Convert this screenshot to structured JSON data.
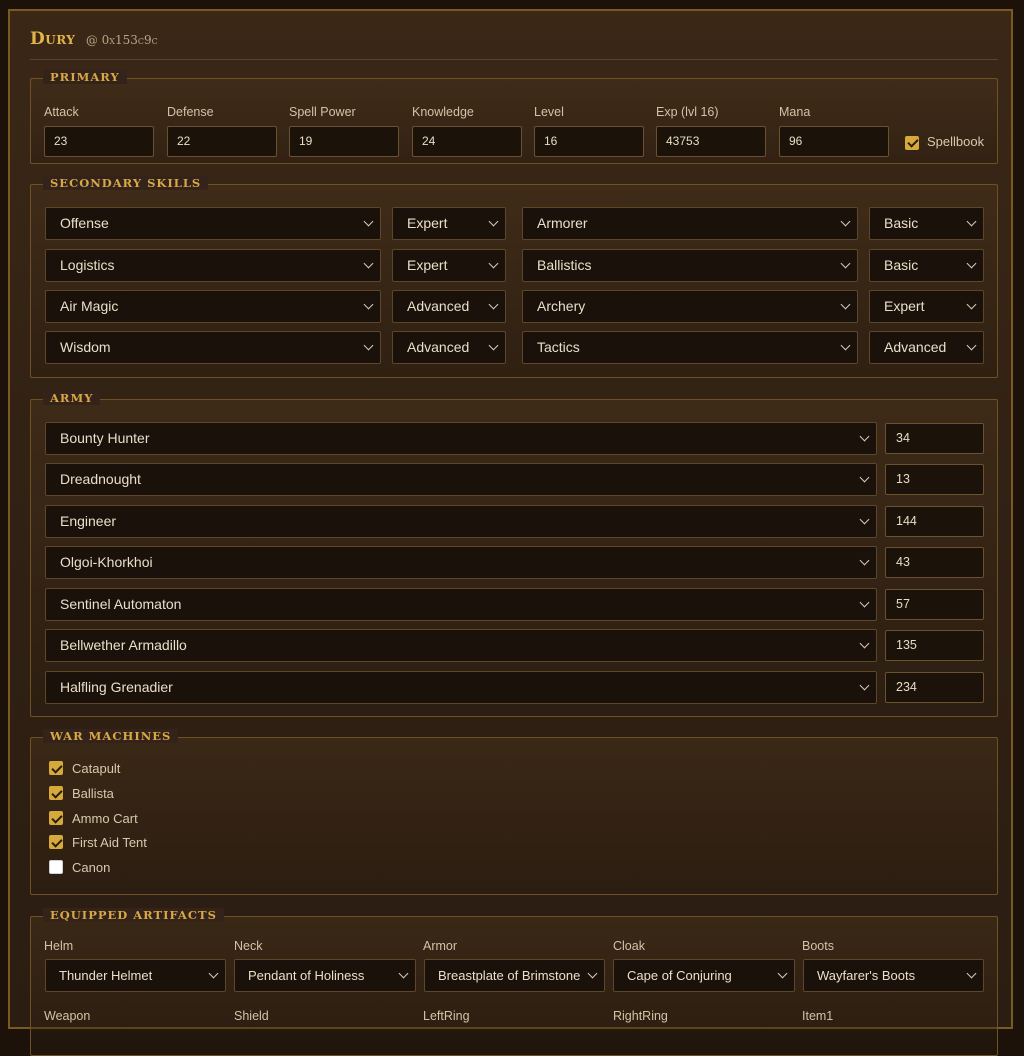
{
  "hero": {
    "name": "Dury",
    "address": "@ 0x153c9c"
  },
  "primary": {
    "legend": "PRIMARY",
    "stats": [
      {
        "label": "Attack",
        "value": "23"
      },
      {
        "label": "Defense",
        "value": "22"
      },
      {
        "label": "Spell Power",
        "value": "19"
      },
      {
        "label": "Knowledge",
        "value": "24"
      },
      {
        "label": "Level",
        "value": "16"
      },
      {
        "label": "Exp (lvl 16)",
        "value": "43753"
      },
      {
        "label": "Mana",
        "value": "96"
      }
    ],
    "spellbook_label": "Spellbook",
    "spellbook_checked": true
  },
  "secondary": {
    "legend": "SECONDARY SKILLS",
    "skills": [
      {
        "name": "Offense",
        "level": "Expert"
      },
      {
        "name": "Armorer",
        "level": "Basic"
      },
      {
        "name": "Logistics",
        "level": "Expert"
      },
      {
        "name": "Ballistics",
        "level": "Basic"
      },
      {
        "name": "Air Magic",
        "level": "Advanced"
      },
      {
        "name": "Archery",
        "level": "Expert"
      },
      {
        "name": "Wisdom",
        "level": "Advanced"
      },
      {
        "name": "Tactics",
        "level": "Advanced"
      }
    ]
  },
  "army": {
    "legend": "ARMY",
    "units": [
      {
        "name": "Bounty Hunter",
        "count": "34"
      },
      {
        "name": "Dreadnought",
        "count": "13"
      },
      {
        "name": "Engineer",
        "count": "144"
      },
      {
        "name": "Olgoi-Khorkhoi",
        "count": "43"
      },
      {
        "name": "Sentinel Automaton",
        "count": "57"
      },
      {
        "name": "Bellwether Armadillo",
        "count": "135"
      },
      {
        "name": "Halfling Grenadier",
        "count": "234"
      }
    ]
  },
  "war_machines": {
    "legend": "WAR MACHINES",
    "items": [
      {
        "label": "Catapult",
        "checked": true
      },
      {
        "label": "Ballista",
        "checked": true
      },
      {
        "label": "Ammo Cart",
        "checked": true
      },
      {
        "label": "First Aid Tent",
        "checked": true
      },
      {
        "label": "Canon",
        "checked": false
      }
    ]
  },
  "artifacts": {
    "legend": "EQUIPPED ARTIFACTS",
    "slots": [
      {
        "label": "Helm",
        "value": "Thunder Helmet"
      },
      {
        "label": "Neck",
        "value": "Pendant of Holiness"
      },
      {
        "label": "Armor",
        "value": "Breastplate of Brimstone"
      },
      {
        "label": "Cloak",
        "value": "Cape of Conjuring"
      },
      {
        "label": "Boots",
        "value": "Wayfarer's Boots"
      }
    ],
    "next_row_labels": [
      "Weapon",
      "Shield",
      "LeftRing",
      "RightRing",
      "Item1"
    ]
  },
  "colors": {
    "accent": "#d9a843",
    "panel_border": "#7a5a22",
    "checkbox_on": "#d6aa3a"
  }
}
